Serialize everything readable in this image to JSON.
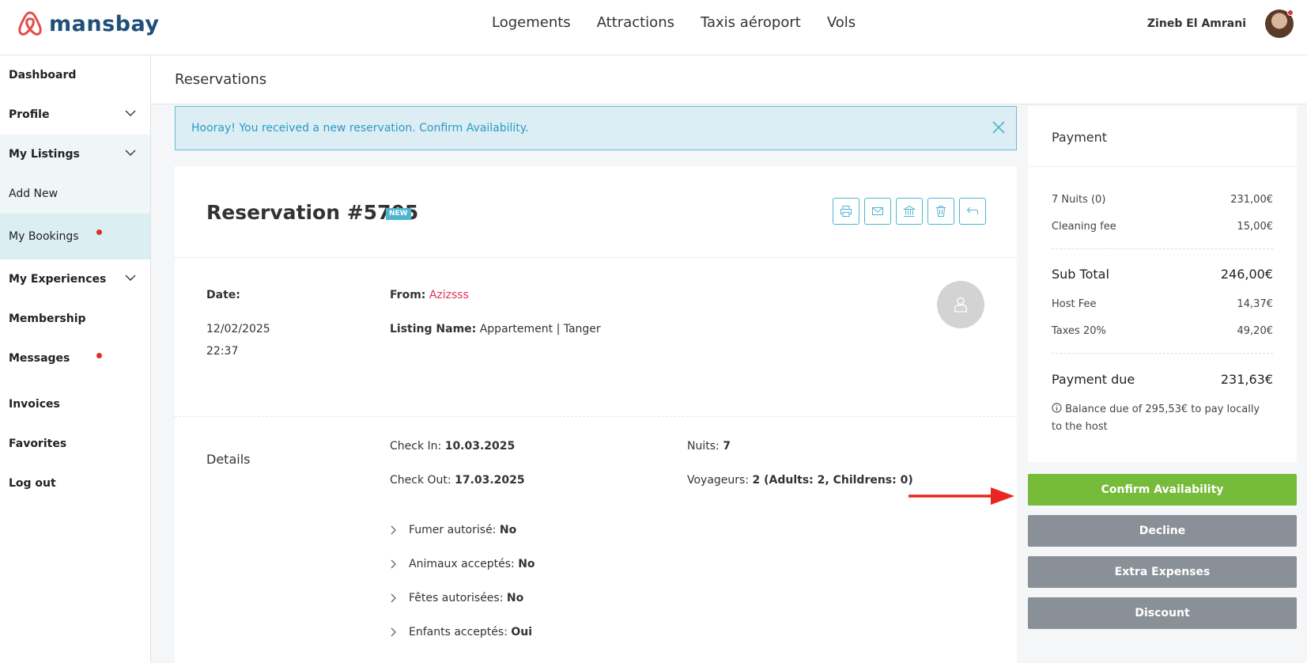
{
  "brand": {
    "name": "mansbay",
    "color": "#1f4f7a",
    "logo_color": "#e0504a"
  },
  "nav": {
    "items": [
      "Logements",
      "Attractions",
      "Taxis aéroport",
      "Vols"
    ]
  },
  "user": {
    "name": "Zineb El Amrani",
    "has_notification": true
  },
  "sidebar": {
    "items": [
      {
        "label": "Dashboard"
      },
      {
        "label": "Profile",
        "expandable": true
      },
      {
        "label": "My Listings",
        "expandable": true
      },
      {
        "label": "Add New"
      },
      {
        "label": "My Bookings",
        "active": true,
        "notification": true
      },
      {
        "label": "My Experiences",
        "expandable": true
      },
      {
        "label": "Membership"
      },
      {
        "label": "Messages",
        "notification": true
      },
      {
        "label": "Invoices"
      },
      {
        "label": "Favorites"
      },
      {
        "label": "Log out"
      }
    ]
  },
  "page": {
    "title": "Reservations"
  },
  "alert": {
    "text": "Hooray! You received a new reservation. Confirm Availability."
  },
  "reservation": {
    "title": "Reservation #5705",
    "badge": "NEW",
    "date_label": "Date:",
    "date": "12/02/2025",
    "time": "22:37",
    "from_label": "From:",
    "guest": "Azizsss",
    "listing_label": "Listing Name:",
    "listing": "Appartement | Tanger",
    "details_title": "Details",
    "checkin_label": "Check In:",
    "checkin": "10.03.2025",
    "checkout_label": "Check Out:",
    "checkout": "17.03.2025",
    "nights_label": "Nuits:",
    "nights": "7",
    "guests_label": "Voyageurs:",
    "guests": "2 (Adults: 2, Childrens: 0)",
    "rules": [
      {
        "label": "Fumer autorisé:",
        "value": "No"
      },
      {
        "label": "Animaux acceptés:",
        "value": "No"
      },
      {
        "label": "Fêtes autorisées:",
        "value": "No"
      },
      {
        "label": "Enfants acceptés:",
        "value": "Oui"
      }
    ]
  },
  "payment": {
    "title": "Payment",
    "nights_label": "7 Nuits (0)",
    "nights_amount": "231,00€",
    "cleaning_label": "Cleaning fee",
    "cleaning_amount": "15,00€",
    "subtotal_label": "Sub Total",
    "subtotal_amount": "246,00€",
    "host_fee_label": "Host Fee",
    "host_fee_amount": "14,37€",
    "taxes_label": "Taxes 20%",
    "taxes_amount": "49,20€",
    "due_label": "Payment due",
    "due_amount": "231,63€",
    "note": "Balance due of 295,53€ to pay locally to the host"
  },
  "buttons": {
    "confirm": "Confirm Availability",
    "decline": "Decline",
    "extra": "Extra Expenses",
    "discount": "Discount"
  },
  "colors": {
    "confirm": "#77bb3b",
    "secondary": "#8a9098",
    "accent": "#4eb5cf",
    "alert_bg": "#dcedf4",
    "notification": "#d9302a",
    "annotation_arrow": "#e8261f"
  }
}
